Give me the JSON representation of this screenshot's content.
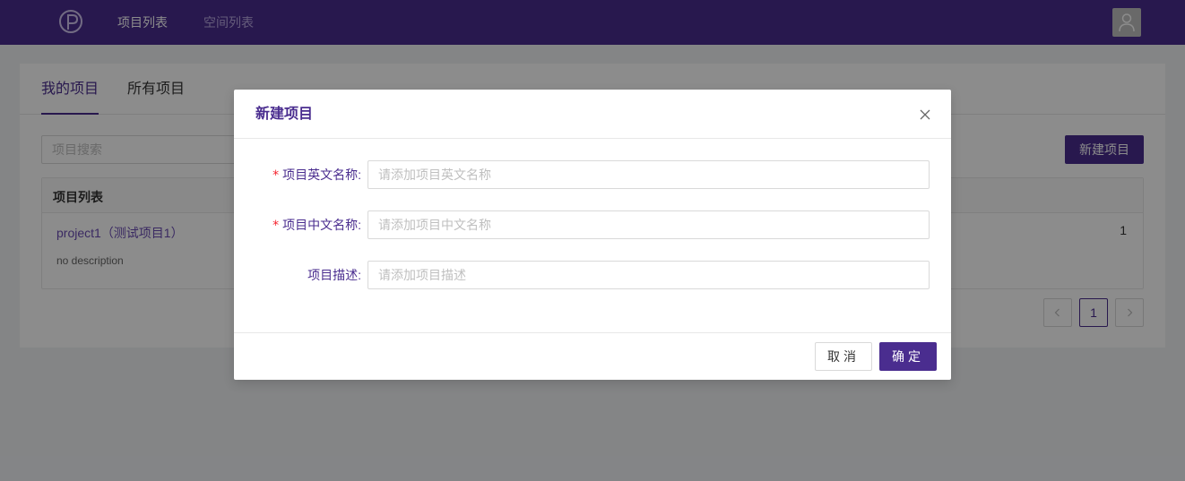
{
  "nav": {
    "logo_icon": "p-logo-icon",
    "items": [
      {
        "label": "项目列表",
        "active": true
      },
      {
        "label": "空间列表",
        "active": false
      }
    ],
    "avatar_icon": "user-icon"
  },
  "main": {
    "tabs": [
      {
        "label": "我的项目",
        "active": true
      },
      {
        "label": "所有项目",
        "active": false
      }
    ],
    "search_placeholder": "项目搜索",
    "new_project_label": "新建项目",
    "list_header": "项目列表",
    "projects": [
      {
        "title": "project1（测试项目1）",
        "description": "no description",
        "count": "1"
      }
    ],
    "pagination": {
      "current": "1"
    }
  },
  "modal": {
    "title": "新建项目",
    "close_icon": "close-icon",
    "fields": [
      {
        "label": "项目英文名称",
        "required": true,
        "placeholder": "请添加项目英文名称",
        "value": ""
      },
      {
        "label": "项目中文名称",
        "required": true,
        "placeholder": "请添加项目中文名称",
        "value": ""
      },
      {
        "label": "项目描述",
        "required": false,
        "placeholder": "请添加项目描述",
        "value": ""
      }
    ],
    "cancel_label": "取消",
    "ok_label": "确定"
  },
  "colors": {
    "brand": "#4a2d8f",
    "required": "#f5222d"
  }
}
